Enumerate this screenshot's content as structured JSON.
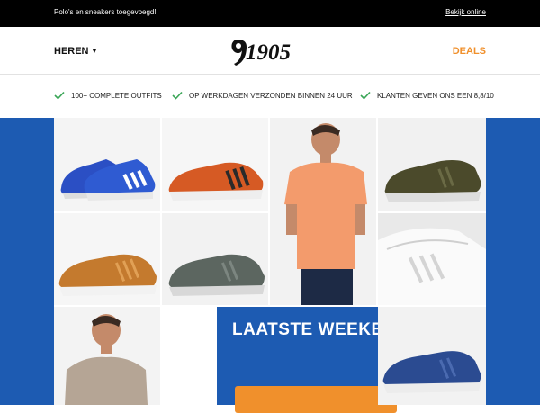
{
  "topbar": {
    "promo": "Polo's en sneakers toegevoegd!",
    "view_online": "Bekijk online"
  },
  "header": {
    "menu_label": "HEREN",
    "logo_text": "1905",
    "deals_label": "DEALS"
  },
  "usps": [
    {
      "text": "100+ COMPLETE OUTFITS"
    },
    {
      "text": "OP WERKDAGEN VERZONDEN BINNEN 24 UUR"
    },
    {
      "text": "KLANTEN GEVEN ONS EEN 8,8/10"
    }
  ],
  "banner": {
    "headline": "LAATSTE WEEKEND!"
  },
  "colors": {
    "accent": "#f0902c",
    "hero_blue": "#1d5bb2",
    "check_green": "#3aa657"
  }
}
